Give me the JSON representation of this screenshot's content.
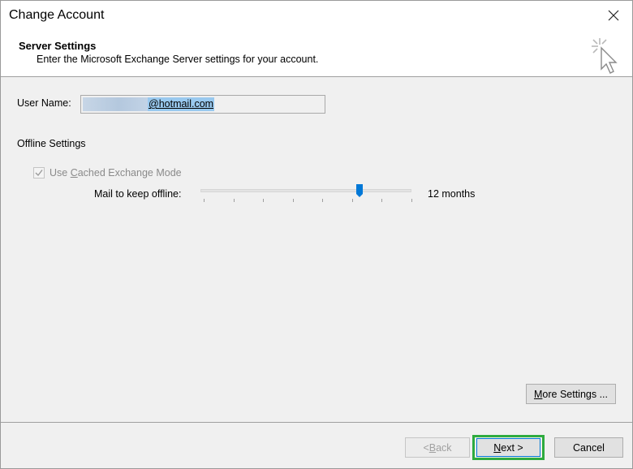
{
  "window": {
    "title": "Change Account"
  },
  "header": {
    "title": "Server Settings",
    "subtitle": "Enter the Microsoft Exchange Server settings for your account."
  },
  "user": {
    "label": "User Name:",
    "value": "@hotmail.com"
  },
  "offline": {
    "section_label": "Offline Settings",
    "cached_mode": {
      "label_prefix": "Use ",
      "label_accel": "C",
      "label_rest": "ached Exchange Mode",
      "checked": true,
      "enabled": false
    },
    "mail_label": "Mail to keep offline:",
    "slider": {
      "value_text": "12 months",
      "level": 0.75,
      "ticks": 8
    }
  },
  "buttons": {
    "more_settings": {
      "accel": "M",
      "rest": "ore Settings ..."
    },
    "back": {
      "prefix": "< ",
      "accel": "B",
      "rest": "ack"
    },
    "next": {
      "accel": "N",
      "rest": "ext >"
    },
    "cancel": "Cancel"
  },
  "colors": {
    "accent": "#0078d7",
    "highlight": "#2eab3f",
    "selection": "#99c9ef"
  }
}
